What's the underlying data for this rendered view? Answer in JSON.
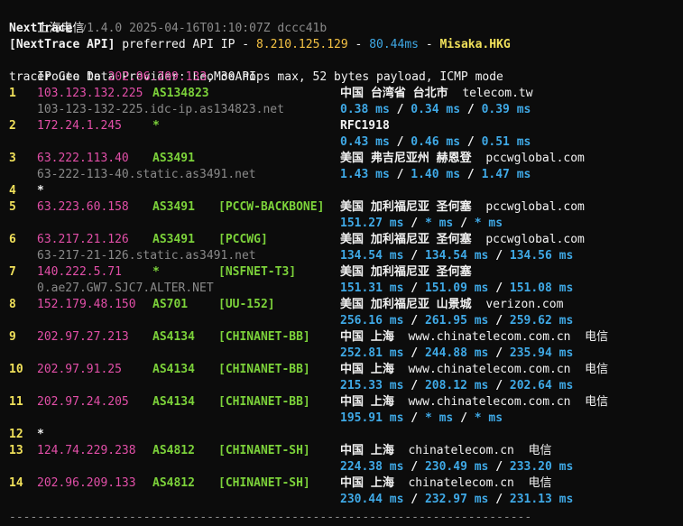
{
  "header": {
    "window_title": "上海电信",
    "app_name": "NextTrace",
    "version_info": "v1.4.0 2025-04-16T01:10:07Z dccc41b",
    "api_tag": "[NextTrace API]",
    "api_text": "preferred API IP -",
    "api_ip": "8.210.125.129",
    "sep1": "-",
    "api_latency": "80.44ms",
    "sep2": "-",
    "api_node": "Misaka.HKG",
    "geo_provider_line": "IP Geo Data Provider: LeoMoeAPI",
    "traceroute_prefix": "traceroute to",
    "traceroute_target": "202.96.209.133",
    "traceroute_suffix": ", 30 hops max, 52 bytes payload, ICMP mode"
  },
  "hops": [
    {
      "num": "1",
      "ip": "103.123.132.225",
      "asn": "AS134823",
      "tag": "",
      "geo": "中国 台湾省 台北市",
      "domain": "telecom.tw",
      "isp": "",
      "hostname": "103-123-132-225.idc-ip.as134823.net",
      "t1": "0.38 ms",
      "t2": "0.34 ms",
      "t3": "0.39 ms"
    },
    {
      "num": "2",
      "ip": "172.24.1.245",
      "asn": "*",
      "tag": "",
      "geo": "RFC1918",
      "domain": "",
      "isp": "",
      "hostname": "",
      "t1": "0.43 ms",
      "t2": "0.46 ms",
      "t3": "0.51 ms"
    },
    {
      "num": "3",
      "ip": "63.222.113.40",
      "asn": "AS3491",
      "tag": "",
      "geo": "美国 弗吉尼亚州 赫恩登",
      "domain": "pccwglobal.com",
      "isp": "",
      "hostname": "63-222-113-40.static.as3491.net",
      "t1": "1.43 ms",
      "t2": "1.40 ms",
      "t3": "1.47 ms"
    },
    {
      "num": "4",
      "star": "*"
    },
    {
      "num": "5",
      "ip": "63.223.60.158",
      "asn": "AS3491",
      "tag": "[PCCW-BACKBONE]",
      "geo": "美国 加利福尼亚 圣何塞",
      "domain": "pccwglobal.com",
      "isp": "",
      "hostname": "",
      "t1": "151.27 ms",
      "t2": "* ms",
      "t3": "* ms"
    },
    {
      "num": "6",
      "ip": "63.217.21.126",
      "asn": "AS3491",
      "tag": "[PCCWG]",
      "geo": "美国 加利福尼亚 圣何塞",
      "domain": "pccwglobal.com",
      "isp": "",
      "hostname": "63-217-21-126.static.as3491.net",
      "t1": "134.54 ms",
      "t2": "134.54 ms",
      "t3": "134.56 ms"
    },
    {
      "num": "7",
      "ip": "140.222.5.71",
      "asn": "*",
      "tag": "[NSFNET-T3]",
      "geo": "美国 加利福尼亚 圣何塞",
      "domain": "",
      "isp": "",
      "hostname": "0.ae27.GW7.SJC7.ALTER.NET",
      "t1": "151.31 ms",
      "t2": "151.09 ms",
      "t3": "151.08 ms"
    },
    {
      "num": "8",
      "ip": "152.179.48.150",
      "asn": "AS701",
      "tag": "[UU-152]",
      "geo": "美国 加利福尼亚 山景城",
      "domain": "verizon.com",
      "isp": "",
      "hostname": "",
      "t1": "256.16 ms",
      "t2": "261.95 ms",
      "t3": "259.62 ms"
    },
    {
      "num": "9",
      "ip": "202.97.27.213",
      "asn": "AS4134",
      "tag": "[CHINANET-BB]",
      "geo": "中国 上海",
      "domain": "www.chinatelecom.com.cn",
      "isp": "电信",
      "hostname": "",
      "t1": "252.81 ms",
      "t2": "244.88 ms",
      "t3": "235.94 ms"
    },
    {
      "num": "10",
      "ip": "202.97.91.25",
      "asn": "AS4134",
      "tag": "[CHINANET-BB]",
      "geo": "中国 上海",
      "domain": "www.chinatelecom.com.cn",
      "isp": "电信",
      "hostname": "",
      "t1": "215.33 ms",
      "t2": "208.12 ms",
      "t3": "202.64 ms"
    },
    {
      "num": "11",
      "ip": "202.97.24.205",
      "asn": "AS4134",
      "tag": "[CHINANET-BB]",
      "geo": "中国 上海",
      "domain": "www.chinatelecom.com.cn",
      "isp": "电信",
      "hostname": "",
      "t1": "195.91 ms",
      "t2": "* ms",
      "t3": "* ms"
    },
    {
      "num": "12",
      "star": "*"
    },
    {
      "num": "13",
      "ip": "124.74.229.238",
      "asn": "AS4812",
      "tag": "[CHINANET-SH]",
      "geo": "中国 上海",
      "domain": "chinatelecom.cn",
      "isp": "电信",
      "hostname": "",
      "t1": "224.38 ms",
      "t2": "230.49 ms",
      "t3": "233.20 ms"
    },
    {
      "num": "14",
      "ip": "202.96.209.133",
      "asn": "AS4812",
      "tag": "[CHINANET-SH]",
      "geo": "中国 上海",
      "domain": "chinatelecom.cn",
      "isp": "电信",
      "hostname": "",
      "t1": "230.44 ms",
      "t2": "232.97 ms",
      "t3": "231.13 ms"
    }
  ],
  "timing_separator": "/",
  "footer_rule": "--------------------------------------------------------------------------"
}
